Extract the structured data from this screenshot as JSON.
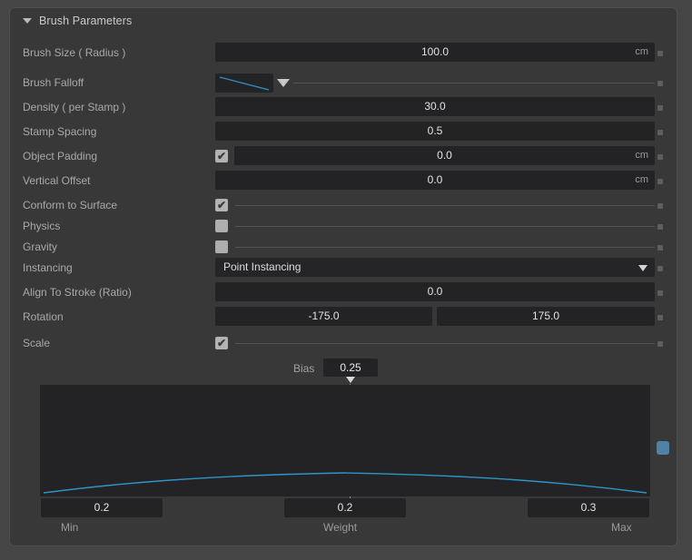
{
  "panel": {
    "title": "Brush Parameters",
    "collapse_icon": "triangle-down-icon"
  },
  "rows": [
    {
      "label": "Brush Size ( Radius )",
      "value": "100.0",
      "unit": "cm"
    },
    {
      "label": "Brush Falloff",
      "value": "",
      "unit": ""
    },
    {
      "label": "Density ( per Stamp )",
      "value": "30.0",
      "unit": ""
    },
    {
      "label": "Stamp Spacing",
      "value": "0.5",
      "unit": ""
    },
    {
      "label": "Object Padding",
      "value": "0.0",
      "unit": "cm",
      "checked": true
    },
    {
      "label": "Vertical Offset",
      "value": "0.0",
      "unit": "cm"
    },
    {
      "label": "Conform to Surface",
      "checked": true
    },
    {
      "label": "Physics",
      "checked": false
    },
    {
      "label": "Gravity",
      "checked": false
    },
    {
      "label": "Instancing",
      "value": "Point Instancing"
    },
    {
      "label": "Align To Stroke (Ratio)",
      "value": "0.0",
      "unit": ""
    },
    {
      "label": "Rotation",
      "value_min": "-175.0",
      "value_max": "175.0"
    },
    {
      "label": "Scale",
      "checked": true
    }
  ],
  "bias": {
    "label": "Bias",
    "value": "0.25"
  },
  "curve_editor": {
    "min_value": "0.2",
    "weight_value": "0.2",
    "max_value": "0.3",
    "min_label": "Min",
    "weight_label": "Weight",
    "max_label": "Max"
  },
  "chart_data": {
    "type": "line",
    "title": "",
    "xlabel": "",
    "ylabel": "",
    "x": [
      0,
      0.125,
      0.25,
      0.375,
      0.5,
      0.625,
      0.75,
      0.875,
      1
    ],
    "y": [
      0.2,
      0.238,
      0.268,
      0.288,
      0.3,
      0.295,
      0.278,
      0.248,
      0.2
    ],
    "xlim": [
      0,
      1
    ],
    "ylim": [
      0,
      1
    ],
    "grid": false,
    "legend": null,
    "series_color": "#2f93c8",
    "annotations": [
      {
        "name": "bias-marker",
        "x": 0.5,
        "label": "0.25"
      }
    ]
  },
  "colors": {
    "panel_bg": "#383838",
    "field_bg": "#232325",
    "accent_blue": "#2f93c8",
    "handle_blue": "#4e82a9",
    "label_text": "#a9a9a9",
    "value_text": "#e2e2e2"
  },
  "icons": {
    "collapse": "triangle-down-icon",
    "dropdown": "chevron-down-icon",
    "check": "✔"
  }
}
